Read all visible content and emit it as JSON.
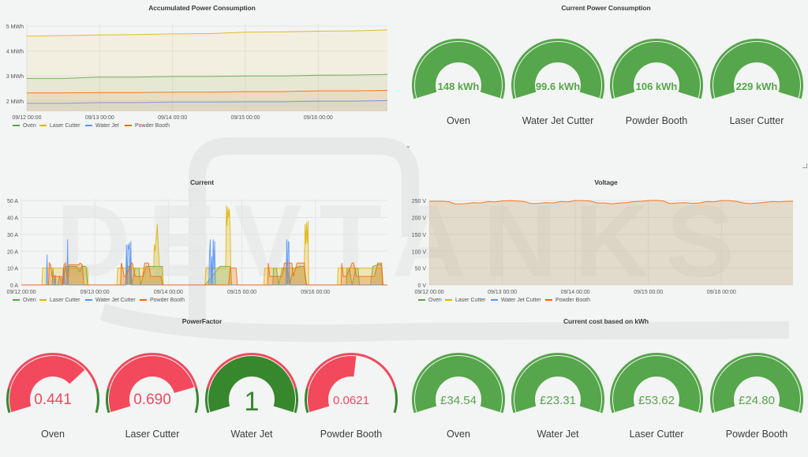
{
  "watermark": "DEVTANKS",
  "colors": {
    "oven": "#56a64b",
    "laser_cutter": "#e0b400",
    "water_jet": "#5794f2",
    "powder_booth": "#fa6400",
    "gauge_green": "#56a64b",
    "gauge_dark_green": "#37872d",
    "gauge_red": "#f2495c",
    "background": "#f3f4f4"
  },
  "chart_data": [
    {
      "id": "accumulated",
      "type": "area",
      "title": "Accumulated Power Consumption",
      "xlabel": "",
      "ylabel": "",
      "x_ticks": [
        "09/12 00:00",
        "09/13 00:00",
        "09/14 00:00",
        "09/15 00:00",
        "09/16 00:00"
      ],
      "x_range_days": [
        0,
        4.95
      ],
      "y_ticks": [
        "2 MWh",
        "3 MWh",
        "4 MWh",
        "5 MWh"
      ],
      "y_tick_values": [
        2,
        3,
        4,
        5
      ],
      "ylim": [
        1.58,
        5.1
      ],
      "grid": true,
      "legend": "bottom-left",
      "series": [
        {
          "name": "Oven",
          "color_key": "oven",
          "x": [
            0,
            0.5,
            1,
            1.5,
            2,
            2.5,
            3,
            3.5,
            4,
            4.5,
            4.95
          ],
          "values": [
            2.9,
            2.9,
            2.95,
            2.95,
            2.98,
            2.98,
            3.0,
            3.0,
            3.03,
            3.04,
            3.06
          ]
        },
        {
          "name": "Laser Cutter",
          "color_key": "laser_cutter",
          "x": [
            0,
            0.5,
            1,
            1.5,
            2,
            2.5,
            3,
            3.5,
            4,
            4.5,
            4.95
          ],
          "values": [
            4.6,
            4.62,
            4.65,
            4.66,
            4.69,
            4.7,
            4.76,
            4.77,
            4.8,
            4.81,
            4.85
          ]
        },
        {
          "name": "Water Jet",
          "color_key": "water_jet",
          "x": [
            0,
            0.5,
            1,
            1.5,
            2,
            2.5,
            3,
            3.5,
            4,
            4.5,
            4.95
          ],
          "values": [
            1.9,
            1.9,
            1.93,
            1.93,
            1.95,
            1.95,
            1.96,
            1.96,
            1.99,
            1.99,
            2.01
          ]
        },
        {
          "name": "Powder Booth",
          "color_key": "powder_booth",
          "x": [
            0,
            0.5,
            1,
            1.5,
            2,
            2.5,
            3,
            3.5,
            4,
            4.5,
            4.95
          ],
          "values": [
            2.32,
            2.32,
            2.33,
            2.33,
            2.35,
            2.35,
            2.37,
            2.37,
            2.4,
            2.4,
            2.42
          ]
        }
      ]
    },
    {
      "id": "current",
      "type": "area",
      "title": "Current",
      "xlabel": "",
      "ylabel": "",
      "x_ticks": [
        "09/12 00:00",
        "09/13 00:00",
        "09/14 00:00",
        "09/15 00:00",
        "09/16 00:00"
      ],
      "x_range_days": [
        0,
        4.98
      ],
      "y_ticks": [
        "0 A",
        "10 A",
        "20 A",
        "30 A",
        "40 A",
        "50 A"
      ],
      "y_tick_values": [
        0,
        10,
        20,
        30,
        40,
        50
      ],
      "ylim": [
        0,
        51
      ],
      "grid": true,
      "legend": "bottom-left",
      "series": [
        {
          "name": "Oven",
          "color_key": "oven",
          "x": [
            0,
            0.42,
            0.43,
            0.45,
            0.5,
            0.52,
            0.56,
            0.6,
            0.62,
            0.7,
            0.75,
            0.8,
            0.82,
            0.85,
            0.88,
            0.9,
            1.3,
            1.42,
            1.43,
            1.47,
            1.5,
            1.55,
            1.6,
            1.62,
            1.7,
            1.72,
            1.75,
            1.8,
            1.82,
            1.92,
            1.93,
            2.5,
            2.7,
            2.71,
            2.85,
            2.86,
            3.3,
            3.42,
            3.43,
            3.47,
            3.5,
            3.55,
            3.62,
            3.65,
            3.7,
            3.72,
            3.78,
            3.82,
            3.85,
            3.88,
            3.9,
            4.3,
            4.42,
            4.43,
            4.46,
            4.5,
            4.55,
            4.58,
            4.6,
            4.75,
            4.78,
            4.85,
            4.9,
            4.92,
            4.98
          ],
          "values": [
            0,
            0,
            10,
            0,
            0,
            5,
            0,
            11,
            11,
            11,
            11,
            8,
            11,
            11,
            11,
            0,
            0,
            0,
            11,
            11,
            0,
            10,
            10,
            0,
            11,
            11,
            11,
            11,
            11,
            11,
            0,
            0,
            11,
            11,
            11,
            0,
            0,
            0,
            10,
            10,
            0,
            10,
            10,
            0,
            10,
            10,
            11,
            11,
            11,
            0,
            0,
            0,
            0,
            10,
            10,
            0,
            10,
            10,
            0,
            0,
            11,
            12,
            12,
            0,
            0
          ]
        },
        {
          "name": "Laser Cutter",
          "color_key": "laser_cutter",
          "x": [
            0,
            0.28,
            0.29,
            0.9,
            0.91,
            1.3,
            1.31,
            1.8,
            1.81,
            1.82,
            1.83,
            1.85,
            1.86,
            1.88,
            1.9,
            1.92,
            1.93,
            2.5,
            2.51,
            2.78,
            2.79,
            2.8,
            2.81,
            2.82,
            2.83,
            2.84,
            2.85,
            2.86,
            3.3,
            3.31,
            3.85,
            3.86,
            3.87,
            3.88,
            3.89,
            3.9,
            3.91,
            4.3,
            4.31,
            4.9,
            4.91,
            4.98
          ],
          "values": [
            0,
            0,
            10,
            10,
            0,
            0,
            10,
            10,
            24,
            20,
            24,
            36,
            26,
            10,
            10,
            10,
            0,
            0,
            10,
            10,
            47,
            35,
            46,
            40,
            45,
            35,
            10,
            0,
            0,
            10,
            10,
            36,
            24,
            37,
            25,
            38,
            0,
            0,
            10,
            10,
            0,
            0
          ]
        },
        {
          "name": "Water Jet Cutter",
          "color_key": "water_jet",
          "x": [
            0,
            0.34,
            0.35,
            0.36,
            0.45,
            0.46,
            0.47,
            0.56,
            0.57,
            0.6,
            0.62,
            0.63,
            0.64,
            0.66,
            1.42,
            1.43,
            1.44,
            1.45,
            1.46,
            1.47,
            1.48,
            1.49,
            1.5,
            1.51,
            2.55,
            2.56,
            2.57,
            2.58,
            2.59,
            2.6,
            2.61,
            2.62,
            2.63,
            2.64,
            2.65,
            3.6,
            3.61,
            3.62,
            3.63,
            3.64,
            3.65,
            3.66,
            4.98
          ],
          "values": [
            0,
            0,
            18,
            0,
            0,
            6,
            0,
            0,
            10,
            0,
            0,
            27,
            0,
            0,
            0,
            24,
            0,
            24,
            21,
            25,
            0,
            26,
            0,
            0,
            0,
            18,
            27,
            0,
            17,
            0,
            27,
            9,
            26,
            0,
            0,
            0,
            27,
            0,
            26,
            25,
            0,
            0,
            0
          ]
        },
        {
          "name": "Powder Booth",
          "color_key": "powder_booth",
          "x": [
            0,
            0.37,
            0.38,
            0.4,
            0.42,
            0.44,
            0.55,
            0.57,
            0.58,
            0.6,
            0.62,
            0.64,
            0.65,
            0.78,
            0.8,
            0.83,
            0.85,
            0.87,
            1.35,
            1.36,
            1.37,
            1.4,
            1.42,
            1.5,
            1.51,
            1.55,
            1.57,
            1.58,
            1.65,
            1.68,
            1.7,
            1.73,
            1.76,
            1.78,
            1.9,
            1.92,
            2.5,
            2.82,
            2.84,
            2.9,
            2.92,
            2.94,
            3.35,
            3.36,
            3.38,
            3.42,
            3.45,
            3.55,
            3.58,
            3.62,
            3.68,
            3.7,
            3.75,
            3.78,
            3.85,
            3.86,
            3.88,
            4.35,
            4.36,
            4.38,
            4.4,
            4.42,
            4.5,
            4.52,
            4.56,
            4.6,
            4.8,
            4.85,
            4.9,
            4.92,
            4.98
          ],
          "values": [
            0,
            0,
            13,
            12,
            5,
            5,
            5,
            0,
            12,
            13,
            5,
            5,
            12,
            12,
            13,
            12,
            0,
            0,
            0,
            13,
            12,
            5,
            5,
            13,
            13,
            5,
            5,
            5,
            5,
            13,
            13,
            13,
            5,
            5,
            5,
            0,
            0,
            0,
            10,
            10,
            10,
            0,
            0,
            13,
            5,
            5,
            5,
            5,
            13,
            13,
            13,
            5,
            13,
            13,
            13,
            5,
            0,
            0,
            13,
            5,
            5,
            5,
            13,
            13,
            5,
            5,
            5,
            13,
            13,
            0,
            0
          ]
        }
      ]
    },
    {
      "id": "voltage",
      "type": "area",
      "title": "Voltage",
      "xlabel": "",
      "ylabel": "",
      "x_ticks": [
        "09/12 00:00",
        "09/13 00:00",
        "09/14 00:00",
        "09/15 00:00",
        "09/16 00:00"
      ],
      "x_range_days": [
        0,
        4.98
      ],
      "y_ticks": [
        "0 V",
        "50 V",
        "100 V",
        "150 V",
        "200 V",
        "250 V"
      ],
      "y_tick_values": [
        0,
        50,
        100,
        150,
        200,
        250
      ],
      "ylim": [
        0,
        255
      ],
      "grid": true,
      "legend": "bottom-left",
      "series": [
        {
          "name": "Oven",
          "color_key": "oven",
          "x": [],
          "values": []
        },
        {
          "name": "Laser Cutter",
          "color_key": "laser_cutter",
          "x": [],
          "values": []
        },
        {
          "name": "Water Jet Cutter",
          "color_key": "water_jet",
          "x": [],
          "values": []
        },
        {
          "name": "Powder Booth",
          "color_key": "powder_booth",
          "x": [
            0,
            0.2,
            0.28,
            0.35,
            0.5,
            0.6,
            0.7,
            0.8,
            0.9,
            1.0,
            1.1,
            1.2,
            1.3,
            1.4,
            1.5,
            1.6,
            1.7,
            1.8,
            1.9,
            2.0,
            2.1,
            2.2,
            2.3,
            2.4,
            2.5,
            2.6,
            2.7,
            2.8,
            2.9,
            3.0,
            3.1,
            3.2,
            3.3,
            3.4,
            3.5,
            3.6,
            3.7,
            3.8,
            3.9,
            4.0,
            4.1,
            4.2,
            4.3,
            4.4,
            4.5,
            4.6,
            4.7,
            4.8,
            4.9,
            4.98
          ],
          "values": [
            248,
            248,
            246,
            240,
            241,
            244,
            243,
            247,
            246,
            249,
            250,
            249,
            247,
            241,
            242,
            244,
            243,
            247,
            246,
            250,
            250,
            249,
            243,
            243,
            240,
            243,
            244,
            247,
            248,
            250,
            251,
            249,
            241,
            243,
            244,
            242,
            243,
            247,
            246,
            250,
            250,
            248,
            243,
            241,
            243,
            245,
            247,
            246,
            248,
            248
          ]
        }
      ]
    }
  ],
  "gauge_panels": [
    {
      "id": "current-power",
      "title": "Current Power Consumption",
      "gauges": [
        {
          "label": "Oven",
          "value_text": "148 kWh",
          "fraction": 1.0,
          "color_key": "gauge_green",
          "thresholds": "green"
        },
        {
          "label": "Water Jet Cutter",
          "value_text": "99.6 kWh",
          "fraction": 1.0,
          "color_key": "gauge_green",
          "thresholds": "green"
        },
        {
          "label": "Powder Booth",
          "value_text": "106 kWh",
          "fraction": 1.0,
          "color_key": "gauge_green",
          "thresholds": "green"
        },
        {
          "label": "Laser Cutter",
          "value_text": "229 kWh",
          "fraction": 1.0,
          "color_key": "gauge_green",
          "thresholds": "green"
        }
      ]
    },
    {
      "id": "power-factor",
      "title": "PowerFactor",
      "range": [
        -1,
        1
      ],
      "gauges": [
        {
          "label": "Oven",
          "value_text": "0.441",
          "value": 0.441,
          "fraction": 0.7205,
          "color_key": "gauge_red",
          "thresholds": "pf"
        },
        {
          "label": "Laser Cutter",
          "value_text": "0.690",
          "value": 0.69,
          "fraction": 0.845,
          "color_key": "gauge_red",
          "thresholds": "pf"
        },
        {
          "label": "Water Jet",
          "value_text": "1",
          "value": 1,
          "fraction": 1.0,
          "color_key": "gauge_dark_green",
          "thresholds": "pf",
          "big": true
        },
        {
          "label": "Powder Booth",
          "value_text": "0.0621",
          "value": 0.0621,
          "fraction": 0.531,
          "color_key": "gauge_red",
          "thresholds": "pf"
        }
      ]
    },
    {
      "id": "cost",
      "title": "Current cost based on kWh",
      "gauges": [
        {
          "label": "Oven",
          "value_text": "£34.54",
          "fraction": 1.0,
          "color_key": "gauge_green",
          "thresholds": "green"
        },
        {
          "label": "Water Jet",
          "value_text": "£23.31",
          "fraction": 1.0,
          "color_key": "gauge_green",
          "thresholds": "green"
        },
        {
          "label": "Laser Cutter",
          "value_text": "£53.62",
          "fraction": 1.0,
          "color_key": "gauge_green",
          "thresholds": "green"
        },
        {
          "label": "Powder Booth",
          "value_text": "£24.80",
          "fraction": 1.0,
          "color_key": "gauge_green",
          "thresholds": "green"
        }
      ]
    }
  ],
  "powerfactor_thresholds": {
    "green_below_fraction": 0.145,
    "green_above_fraction": 0.855
  },
  "controls": {
    "collapse_chevron": "⌄"
  }
}
